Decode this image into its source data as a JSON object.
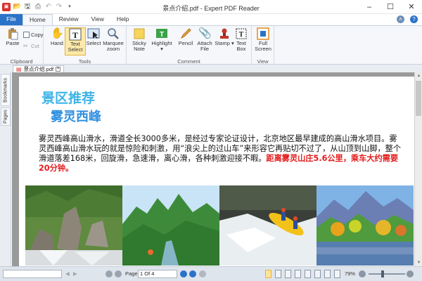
{
  "window": {
    "title": "景点介绍.pdf - Expert PDF Reader"
  },
  "ribbon_tabs": [
    "File",
    "Home",
    "Review",
    "View",
    "Help"
  ],
  "ribbon": {
    "clipboard": {
      "label": "Clipboard",
      "paste": "Paste",
      "copy": "Copy",
      "cut": "Cut"
    },
    "tools": {
      "label": "Tools",
      "hand": "Hand",
      "text_select": "Text Select",
      "select": "Select",
      "marquee_zoom": "Marquee zoom"
    },
    "comment": {
      "label": "Comment",
      "sticky_note": "Sticky Note",
      "highlight": "Highlight",
      "pencil": "Pencil",
      "attach_file": "Attach File",
      "stamp": "Stamp",
      "text_box": "Text Box"
    },
    "view": {
      "label": "View",
      "full_screen": "Full Screen"
    }
  },
  "document_tab": "景点介绍.pdf",
  "side_panel": {
    "bookmarks": "Bookmarks",
    "pages": "Pages"
  },
  "page_content": {
    "heading1": "景区推荐",
    "heading2": "雾灵西峰",
    "paragraph": "雾灵西峰高山滑水，滑道全长3000多米，是经过专家论证设计，北京地区最早建成的高山滑水项目。雾灵西峰高山滑水玩的就是惊险和刺激，用“浪尖上的过山车”来形容它再贴切不过了，从山顶到山脚，整个滑道落差168米，回旋滑，急速滑，离心滑，各种刺激迎接不暇。",
    "highlight": "距离雾灵山庄5.6公里，乘车大约需要20分钟。"
  },
  "status_bar": {
    "page_label": "Page",
    "page_value": "1 Of 4",
    "zoom": "79%"
  },
  "colors": {
    "accent": "#2b73c8",
    "heading1": "#3fb4e8",
    "heading2": "#2f8fe0",
    "highlight_text": "#e31b1b"
  }
}
